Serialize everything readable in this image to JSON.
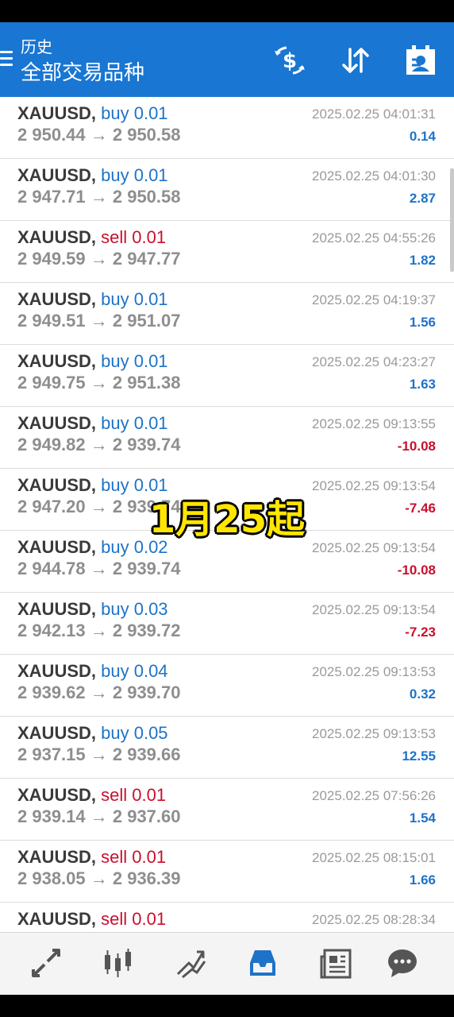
{
  "header": {
    "title": "历史",
    "subtitle": "全部交易品种",
    "icons": [
      "menu-icon",
      "dollar-swap-icon",
      "sort-icon",
      "calendar-icon"
    ]
  },
  "colors": {
    "header": "#1976d2",
    "buy": "#1e73c8",
    "sell": "#c8102e",
    "nav_active": "#1e73c8",
    "nav_inactive": "#555555"
  },
  "trades": [
    {
      "symbol": "XAUUSD,",
      "direction": "buy 0.01",
      "type": "buy",
      "prices": "2 950.44 → 2 950.58",
      "time": "2025.02.25 04:01:31",
      "profit": "0.14",
      "sign": "pos"
    },
    {
      "symbol": "XAUUSD,",
      "direction": "buy 0.01",
      "type": "buy",
      "prices": "2 947.71 → 2 950.58",
      "time": "2025.02.25 04:01:30",
      "profit": "2.87",
      "sign": "pos"
    },
    {
      "symbol": "XAUUSD,",
      "direction": "sell 0.01",
      "type": "sell",
      "prices": "2 949.59 → 2 947.77",
      "time": "2025.02.25 04:55:26",
      "profit": "1.82",
      "sign": "pos"
    },
    {
      "symbol": "XAUUSD,",
      "direction": "buy 0.01",
      "type": "buy",
      "prices": "2 949.51 → 2 951.07",
      "time": "2025.02.25 04:19:37",
      "profit": "1.56",
      "sign": "pos"
    },
    {
      "symbol": "XAUUSD,",
      "direction": "buy 0.01",
      "type": "buy",
      "prices": "2 949.75 → 2 951.38",
      "time": "2025.02.25 04:23:27",
      "profit": "1.63",
      "sign": "pos"
    },
    {
      "symbol": "XAUUSD,",
      "direction": "buy 0.01",
      "type": "buy",
      "prices": "2 949.82 → 2 939.74",
      "time": "2025.02.25 09:13:55",
      "profit": "-10.08",
      "sign": "neg"
    },
    {
      "symbol": "XAUUSD,",
      "direction": "buy 0.01",
      "type": "buy",
      "prices": "2 947.20 → 2 939.74",
      "time": "2025.02.25 09:13:54",
      "profit": "-7.46",
      "sign": "neg"
    },
    {
      "symbol": "XAUUSD,",
      "direction": "buy 0.02",
      "type": "buy",
      "prices": "2 944.78 → 2 939.74",
      "time": "2025.02.25 09:13:54",
      "profit": "-10.08",
      "sign": "neg"
    },
    {
      "symbol": "XAUUSD,",
      "direction": "buy 0.03",
      "type": "buy",
      "prices": "2 942.13 → 2 939.72",
      "time": "2025.02.25 09:13:54",
      "profit": "-7.23",
      "sign": "neg"
    },
    {
      "symbol": "XAUUSD,",
      "direction": "buy 0.04",
      "type": "buy",
      "prices": "2 939.62 → 2 939.70",
      "time": "2025.02.25 09:13:53",
      "profit": "0.32",
      "sign": "pos"
    },
    {
      "symbol": "XAUUSD,",
      "direction": "buy 0.05",
      "type": "buy",
      "prices": "2 937.15 → 2 939.66",
      "time": "2025.02.25 09:13:53",
      "profit": "12.55",
      "sign": "pos"
    },
    {
      "symbol": "XAUUSD,",
      "direction": "sell 0.01",
      "type": "sell",
      "prices": "2 939.14 → 2 937.60",
      "time": "2025.02.25 07:56:26",
      "profit": "1.54",
      "sign": "pos"
    },
    {
      "symbol": "XAUUSD,",
      "direction": "sell 0.01",
      "type": "sell",
      "prices": "2 938.05 → 2 936.39",
      "time": "2025.02.25 08:15:01",
      "profit": "1.66",
      "sign": "pos"
    },
    {
      "symbol": "XAUUSD,",
      "direction": "sell 0.01",
      "type": "sell",
      "prices": "",
      "time": "2025.02.25 08:28:34",
      "profit": "",
      "sign": "pos"
    }
  ],
  "overlay_caption": "1月25起",
  "bottom_nav": {
    "items": [
      "quotes-icon",
      "chart-icon",
      "trade-icon",
      "history-icon",
      "news-icon",
      "chat-icon"
    ],
    "active": "history-icon"
  }
}
